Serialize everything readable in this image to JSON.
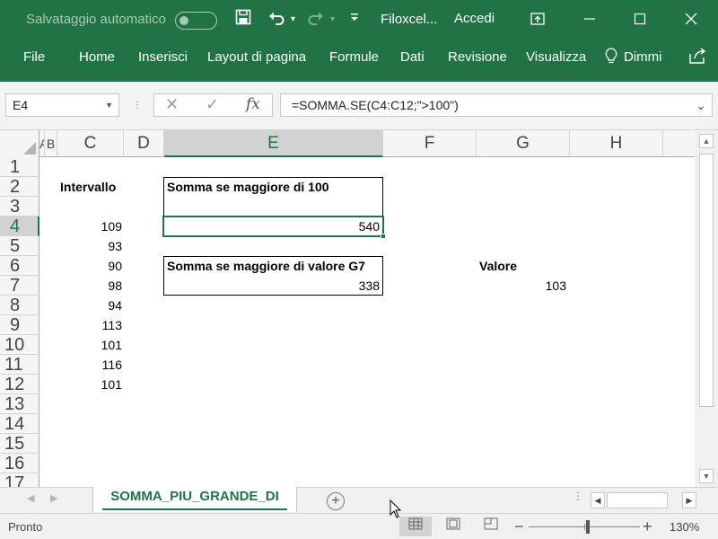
{
  "titlebar": {
    "autosave_label": "Salvataggio automatico",
    "filename": "Filoxcel...",
    "signin": "Accedi",
    "icons": [
      "save-icon",
      "undo-icon",
      "redo-icon",
      "customize-qat-icon",
      "ribbon-display-icon",
      "minimize-icon",
      "maximize-icon",
      "close-icon"
    ]
  },
  "ribbon": {
    "tabs": [
      "File",
      "Home",
      "Inserisci",
      "Layout di pagina",
      "Formule",
      "Dati",
      "Revisione",
      "Visualizza"
    ],
    "tell_me": "Dimmi"
  },
  "formula_bar": {
    "name_box": "E4",
    "formula": "=SOMMA.SE(C4:C12;\">100\")"
  },
  "grid": {
    "columns": [
      "A",
      "B",
      "C",
      "D",
      "E",
      "F",
      "G",
      "H"
    ],
    "rows": [
      "1",
      "2",
      "3",
      "4",
      "5",
      "6",
      "7",
      "8",
      "9",
      "10",
      "11",
      "12",
      "13",
      "14",
      "15",
      "16",
      "17"
    ],
    "active_cell": "E4",
    "intervallo_header": "Intervallo",
    "intervallo_values": [
      "109",
      "93",
      "90",
      "98",
      "94",
      "113",
      "101",
      "116",
      "101"
    ],
    "box1_label": "Somma se maggiore di 100",
    "box1_value": "540",
    "box2_label": "Somma se maggiore di valore G7",
    "box2_value": "338",
    "valore_label": "Valore",
    "valore_value": "103"
  },
  "sheets": {
    "active_tab": "SOMMA_PIU_GRANDE_DI"
  },
  "statusbar": {
    "ready": "Pronto",
    "zoom": "130%"
  },
  "colors": {
    "excel_green": "#217346",
    "header_gray": "#f5f5f5",
    "selected_header": "#d2d2d2"
  }
}
